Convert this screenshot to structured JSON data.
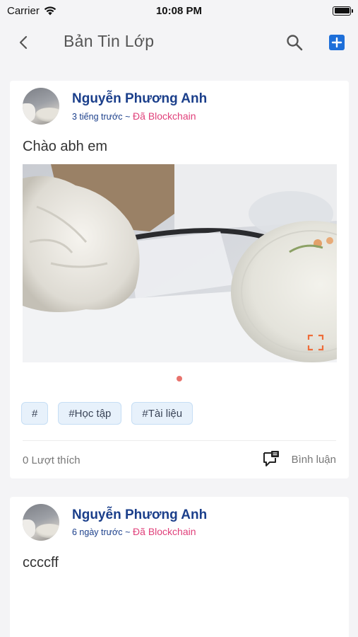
{
  "status_bar": {
    "carrier": "Carrier",
    "time": "10:08 PM"
  },
  "nav": {
    "title": "Bản Tin Lớp",
    "icons": {
      "back": "chevron-left-icon",
      "search": "search-icon",
      "add": "plus-square-icon"
    },
    "accent_color": "#1e6fd9"
  },
  "posts": [
    {
      "author": "Nguyễn Phương Anh",
      "time": "3 tiếng trước",
      "separator": "~",
      "group": "Đã Blockchain",
      "text": "Chào abh em",
      "has_photo": true,
      "tags": [
        "#",
        "#Học tập",
        "#Tài liệu"
      ],
      "likes": "0 Lượt thích",
      "comment_label": "Bình luận"
    },
    {
      "author": "Nguyễn Phương Anh",
      "time": "6 ngày trước",
      "separator": "~",
      "group": "Đã Blockchain",
      "text": "ccccff"
    }
  ],
  "colors": {
    "author": "#1b3f8b",
    "group": "#e0407a",
    "tag_bg": "#e7f1fb",
    "dot": "#e8736d"
  }
}
